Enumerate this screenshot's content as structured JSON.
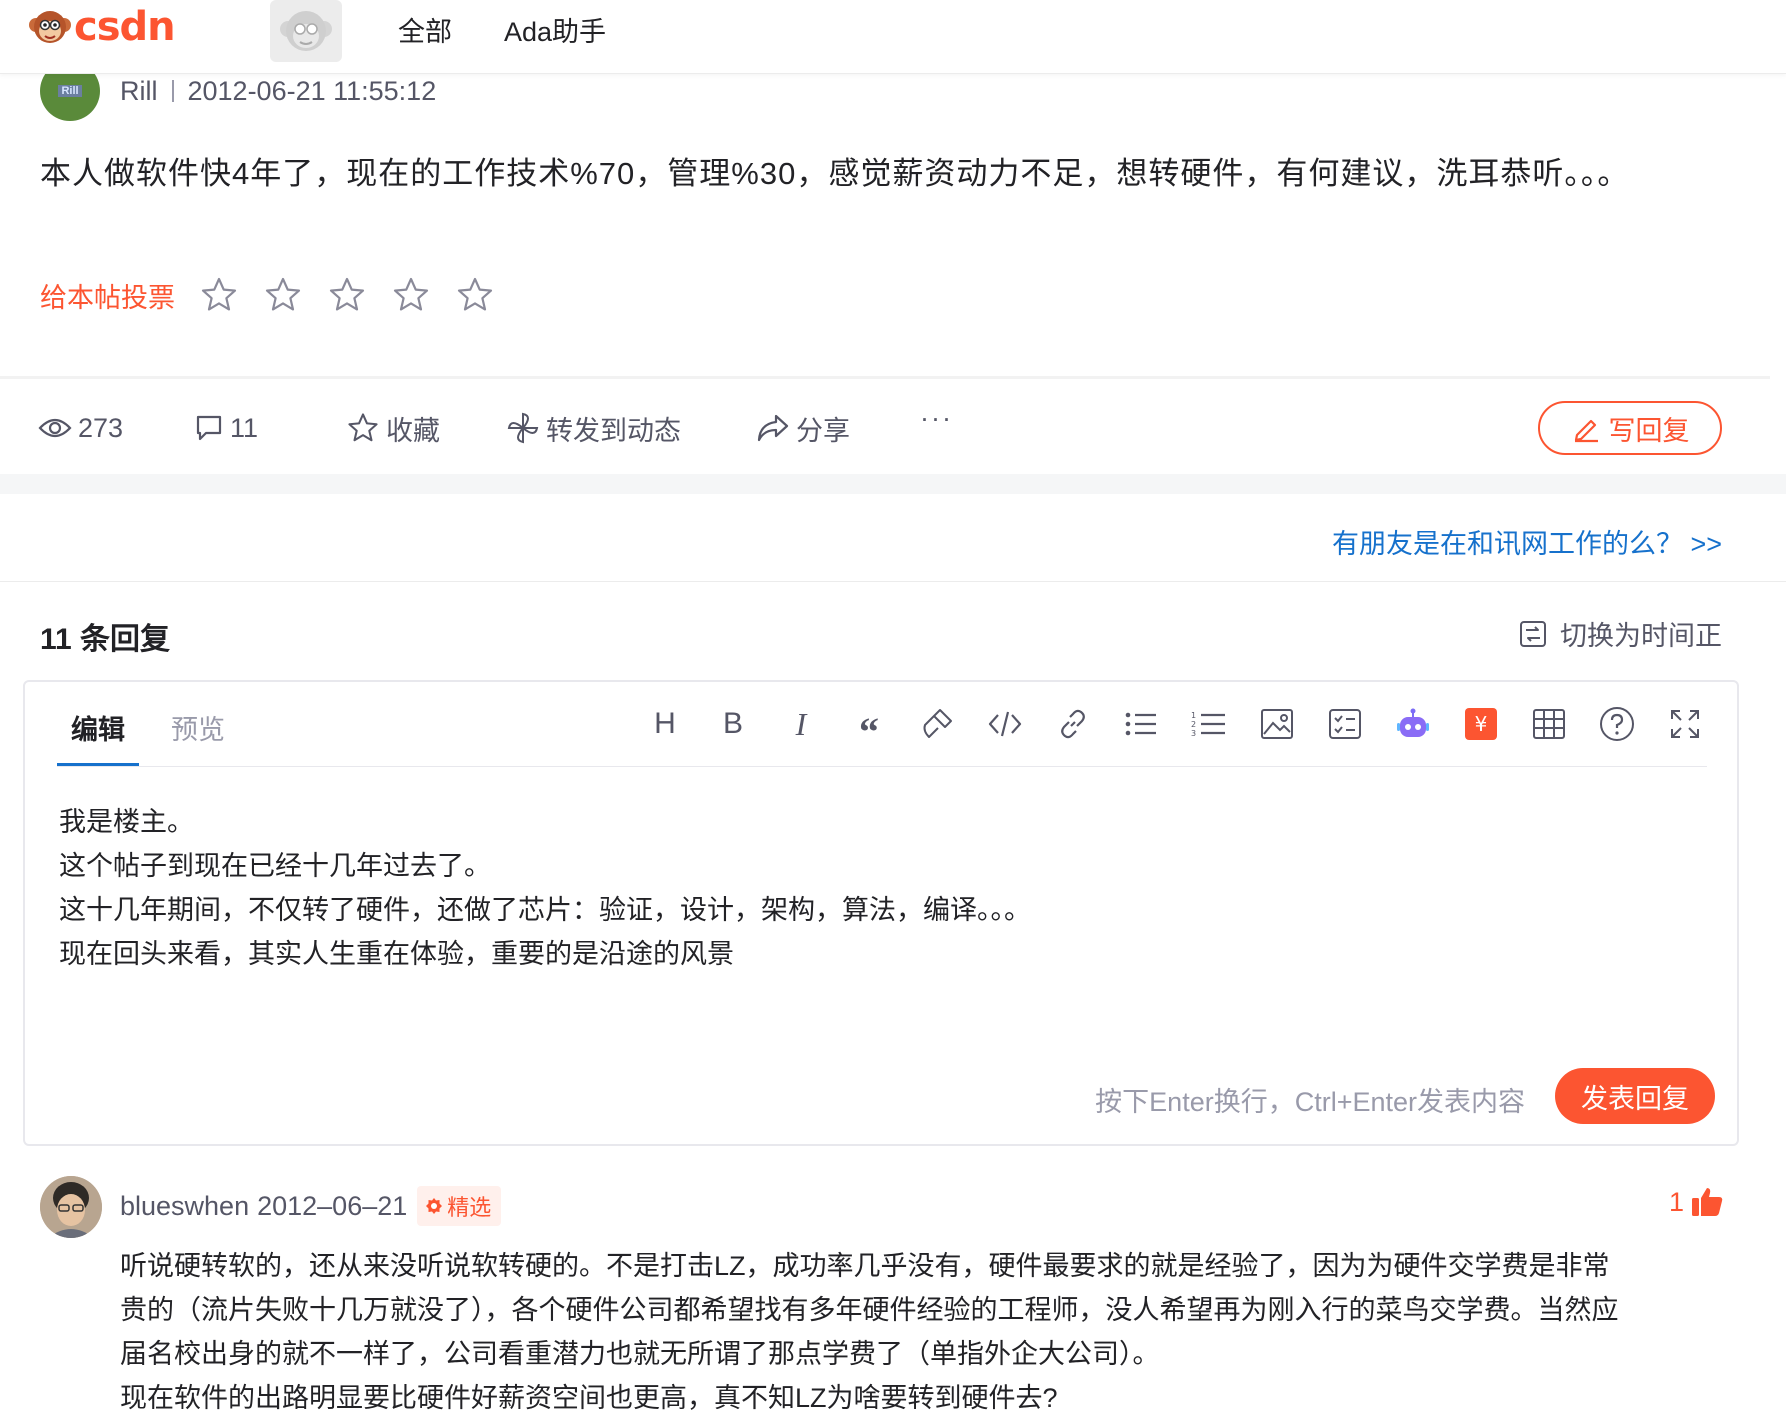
{
  "nav": {
    "logo_text": "csdn",
    "items": [
      "全部",
      "Ada助手"
    ]
  },
  "post": {
    "avatar_text": "Rill",
    "author": "Rill",
    "time": "2012-06-21 11:55:12",
    "body": "本人做软件快4年了，现在的工作技术%70，管理%30，感觉薪资动力不足，想转硬件，有何建议，洗耳恭听。。。",
    "vote_label": "给本帖投票",
    "star_count": 5
  },
  "actions": {
    "views": "273",
    "comments": "11",
    "collect": "收藏",
    "repost": "转发到动态",
    "share": "分享",
    "more": "···",
    "write_reply": "写回复"
  },
  "related": {
    "link": "有朋友是在和讯网工作的么？  >>"
  },
  "replies": {
    "title": "11 条回复",
    "sort_toggle": "切换为时间正"
  },
  "editor": {
    "tabs": [
      "编辑",
      "预览"
    ],
    "active_tab": "编辑",
    "toolbar": [
      "heading-icon",
      "bold-icon",
      "italic-icon",
      "quote-icon",
      "format-brush-icon",
      "code-icon",
      "link-icon",
      "bullet-list-icon",
      "numbered-list-icon",
      "image-icon",
      "checklist-icon",
      "ai-robot-icon",
      "reward-icon",
      "table-icon",
      "help-icon",
      "fullscreen-icon"
    ],
    "content_lines": [
      "我是楼主。",
      "这个帖子到现在已经十几年过去了。",
      "这十几年期间，不仅转了硬件，还做了芯片：验证，设计，架构，算法，编译。。。",
      "现在回头来看，其实人生重在体验，重要的是沿途的风景"
    ],
    "hint": "按下Enter换行，Ctrl+Enter发表内容",
    "submit": "发表回复"
  },
  "comment": {
    "author": "blueswhen",
    "date": "2012–06–21",
    "badge": "精选",
    "likes": "1",
    "lines": [
      "听说硬转软的，还从来没听说软转硬的。不是打击LZ，成功率几乎没有，硬件最要求的就是经验了，因为为硬件交学费是非常",
      "贵的（流片失败十几万就没了），各个硬件公司都希望找有多年硬件经验的工程师，没人希望再为刚入行的菜鸟交学费。当然应",
      "届名校出身的就不一样了，公司看重潜力也就无所谓了那点学费了（单指外企大公司）。",
      "现在软件的出路明显要比硬件好薪资空间也更高，真不知LZ为啥要转到硬件去?"
    ]
  },
  "colors": {
    "brand": "#fc5531",
    "link": "#1671cc",
    "text": "#222226",
    "muted": "#999aaa"
  }
}
